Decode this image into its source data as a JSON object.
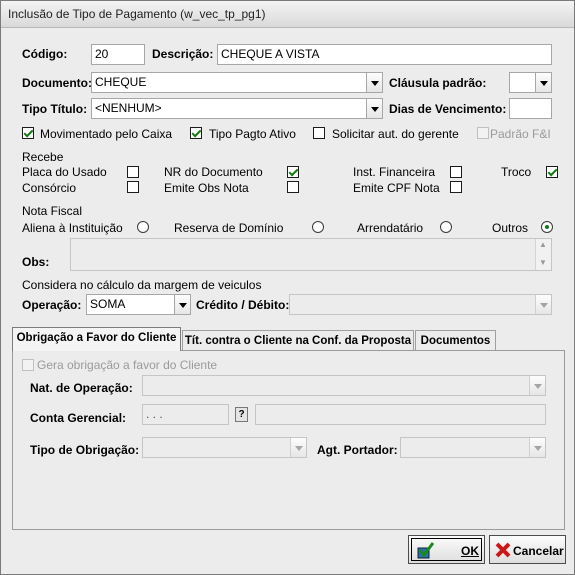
{
  "window": {
    "title": "Inclusão de Tipo de Pagamento (w_vec_tp_pg1)"
  },
  "codigo": {
    "label": "Código:",
    "value": "20"
  },
  "descricao": {
    "label": "Descrição:",
    "value": "CHEQUE A VISTA"
  },
  "documento": {
    "label": "Documento:",
    "value": "CHEQUE"
  },
  "clausula": {
    "label": "Cláusula padrão:",
    "value": ""
  },
  "tipo_titulo": {
    "label": "Tipo Título:",
    "value": "<NENHUM>"
  },
  "dias_vencimento": {
    "label": "Dias de Vencimento:",
    "value": ""
  },
  "checks_row": [
    {
      "label": "Movimentado pelo Caixa",
      "checked": true,
      "enabled": true
    },
    {
      "label": "Tipo Pagto Ativo",
      "checked": true,
      "enabled": true
    },
    {
      "label": "Solicitar aut. do gerente",
      "checked": false,
      "enabled": true
    },
    {
      "label": "Padrão F&I",
      "checked": false,
      "enabled": false
    }
  ],
  "recebe": {
    "title": "Recebe",
    "items": [
      {
        "label": "Placa do Usado",
        "checked": false
      },
      {
        "label": "Consórcio",
        "checked": false
      },
      {
        "label": "NR do Documento",
        "checked": true
      },
      {
        "label": "Emite Obs Nota",
        "checked": false
      },
      {
        "label": "Inst. Financeira",
        "checked": false
      },
      {
        "label": "Emite CPF Nota",
        "checked": false
      },
      {
        "label": "Troco",
        "checked": true
      }
    ]
  },
  "nota_fiscal": {
    "title": "Nota Fiscal",
    "options": [
      "Aliena à Instituição",
      "Reserva de Domínio",
      "Arrendatário",
      "Outros"
    ],
    "selected": "Outros",
    "obs_label": "Obs:",
    "obs_value": ""
  },
  "margem": {
    "title": "Considera no cálculo da margem de veiculos",
    "operacao_label": "Operação:",
    "operacao_value": "SOMA",
    "credito_label": "Crédito / Débito:",
    "credito_value": ""
  },
  "tabs": [
    {
      "label": "Obrigação a Favor do Cliente",
      "selected": true
    },
    {
      "label": "Tít. contra o Cliente na Conf. da Proposta",
      "selected": false
    },
    {
      "label": "Documentos",
      "selected": false
    }
  ],
  "tab_panel": {
    "gera_label": "Gera obrigação a favor do Cliente",
    "gera_checked": false,
    "nat_label": "Nat. de Operação:",
    "nat_value": "",
    "conta_label": "Conta Gerencial:",
    "conta_value": ". . .",
    "conta_desc": "",
    "tipo_obrig_label": "Tipo de Obrigação:",
    "tipo_obrig_value": "",
    "agt_label": "Agt. Portador:",
    "agt_value": ""
  },
  "buttons": {
    "ok": "OK",
    "cancel": "Cancelar"
  },
  "icons": [
    "dropdown-arrow-icon",
    "lookup-icon",
    "ok-check-icon",
    "cancel-x-icon"
  ]
}
